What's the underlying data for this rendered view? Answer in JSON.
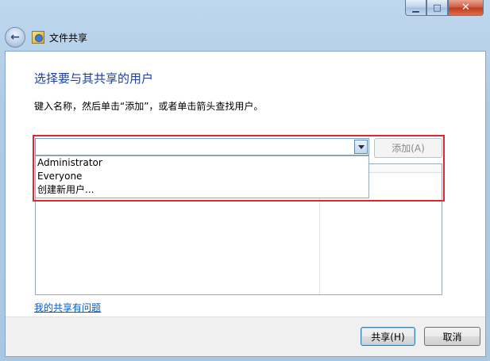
{
  "window": {
    "title": "文件共享",
    "controls": {
      "minimize": "▁",
      "maximize": "□",
      "close": "✕"
    }
  },
  "content": {
    "heading": "选择要与其共享的用户",
    "instruction": "键入名称，然后单击“添加”，或者单击箭头查找用户。",
    "combo_value": "",
    "add_label": "添加(A)",
    "dropdown_items": [
      "Administrator",
      "Everyone",
      "创建新用户..."
    ],
    "help_link": "我的共享有问题"
  },
  "footer": {
    "share_label": "共享(H)",
    "cancel_label": "取消"
  },
  "colors": {
    "heading": "#1e3f9a",
    "link": "#0a5bbf",
    "highlight_box": "#e0272b"
  },
  "icons": {
    "back": "back-arrow-icon",
    "app": "file-sharing-icon",
    "combo": "chevron-down-icon"
  }
}
